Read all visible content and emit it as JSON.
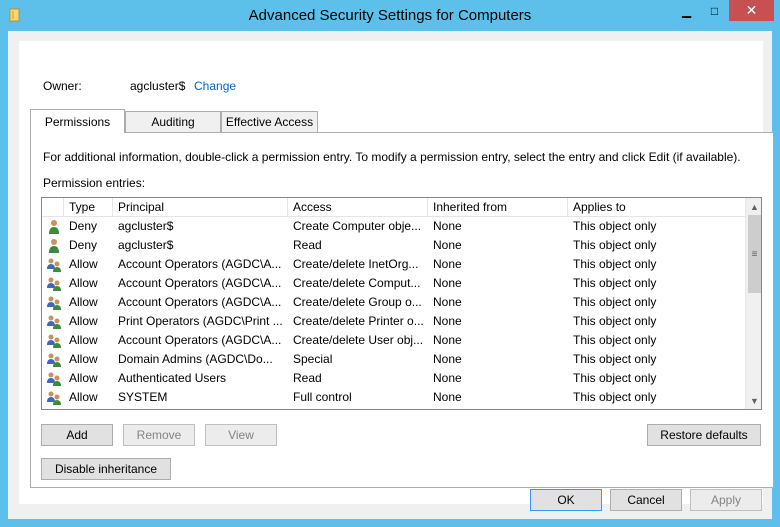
{
  "window": {
    "title": "Advanced Security Settings for Computers",
    "minimize_glyph": "▁",
    "maximize_glyph": "□",
    "close_glyph": "✕"
  },
  "owner": {
    "label": "Owner:",
    "value": "agcluster$",
    "change_link": "Change"
  },
  "tabs": [
    {
      "label": "Permissions",
      "active": true
    },
    {
      "label": "Auditing",
      "active": false
    },
    {
      "label": "Effective Access",
      "active": false
    }
  ],
  "permissions": {
    "info_text": "For additional information, double-click a permission entry. To modify a permission entry, select the entry and click Edit (if available).",
    "entries_label": "Permission entries:",
    "columns": [
      "Type",
      "Principal",
      "Access",
      "Inherited from",
      "Applies to"
    ],
    "rows": [
      {
        "icon": "single-user-icon",
        "type": "Deny",
        "principal": "agcluster$",
        "access": "Create Computer obje...",
        "inherited_from": "None",
        "applies_to": "This object only"
      },
      {
        "icon": "single-user-icon",
        "type": "Deny",
        "principal": "agcluster$",
        "access": "Read",
        "inherited_from": "None",
        "applies_to": "This object only"
      },
      {
        "icon": "group-users-icon",
        "type": "Allow",
        "principal": "Account Operators (AGDC\\A...",
        "access": "Create/delete InetOrg...",
        "inherited_from": "None",
        "applies_to": "This object only"
      },
      {
        "icon": "group-users-icon",
        "type": "Allow",
        "principal": "Account Operators (AGDC\\A...",
        "access": "Create/delete Comput...",
        "inherited_from": "None",
        "applies_to": "This object only"
      },
      {
        "icon": "group-users-icon",
        "type": "Allow",
        "principal": "Account Operators (AGDC\\A...",
        "access": "Create/delete Group o...",
        "inherited_from": "None",
        "applies_to": "This object only"
      },
      {
        "icon": "group-users-icon",
        "type": "Allow",
        "principal": "Print Operators (AGDC\\Print ...",
        "access": "Create/delete Printer o...",
        "inherited_from": "None",
        "applies_to": "This object only"
      },
      {
        "icon": "group-users-icon",
        "type": "Allow",
        "principal": "Account Operators (AGDC\\A...",
        "access": "Create/delete User obj...",
        "inherited_from": "None",
        "applies_to": "This object only"
      },
      {
        "icon": "group-users-icon",
        "type": "Allow",
        "principal": "Domain Admins (AGDC\\Do...",
        "access": "Special",
        "inherited_from": "None",
        "applies_to": "This object only"
      },
      {
        "icon": "group-users-icon",
        "type": "Allow",
        "principal": "Authenticated Users",
        "access": "Read",
        "inherited_from": "None",
        "applies_to": "This object only"
      },
      {
        "icon": "group-users-icon",
        "type": "Allow",
        "principal": "SYSTEM",
        "access": "Full control",
        "inherited_from": "None",
        "applies_to": "This object only"
      }
    ],
    "buttons": {
      "add": "Add",
      "remove": "Remove",
      "view": "View",
      "restore_defaults": "Restore defaults",
      "disable_inheritance": "Disable inheritance"
    }
  },
  "footer": {
    "ok": "OK",
    "cancel": "Cancel",
    "apply": "Apply"
  },
  "colors": {
    "titlebar": "#5cc0ea",
    "close_button": "#c75050",
    "link": "#0066cc",
    "default_button_border": "#3399ff"
  }
}
